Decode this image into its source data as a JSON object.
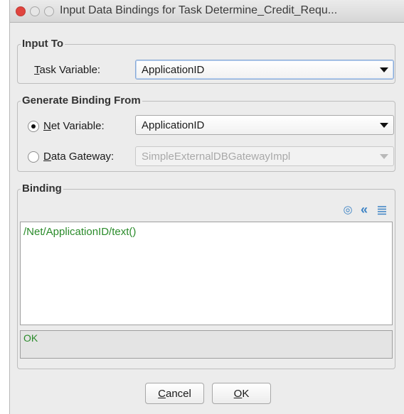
{
  "window": {
    "title": "Input Data Bindings for Task Determine_Credit_Requ..."
  },
  "input_to": {
    "legend": "Input To",
    "task_variable": {
      "label_mnemonic": "T",
      "label_rest": "ask Variable:",
      "value": "ApplicationID"
    }
  },
  "generate_binding": {
    "legend": "Generate Binding From",
    "net_variable": {
      "label_mnemonic": "N",
      "label_rest": "et Variable:",
      "value": "ApplicationID",
      "selected": true
    },
    "data_gateway": {
      "label_mnemonic": "D",
      "label_rest": "ata Gateway:",
      "value": "SimpleExternalDBGatewayImpl",
      "selected": false,
      "enabled": false
    }
  },
  "binding": {
    "legend": "Binding",
    "toolbar_icons": [
      "target-icon",
      "double-chevron-left-icon",
      "format-lines-icon"
    ],
    "expression": "/Net/ApplicationID/text()",
    "status": "OK"
  },
  "buttons": {
    "cancel_mnemonic": "C",
    "cancel_rest": "ancel",
    "ok_mnemonic": "O",
    "ok_rest": "K"
  },
  "colors": {
    "expression_text": "#2a8b2a",
    "toolbar_icon": "#3b82c4",
    "close_light": "#e0443e"
  }
}
